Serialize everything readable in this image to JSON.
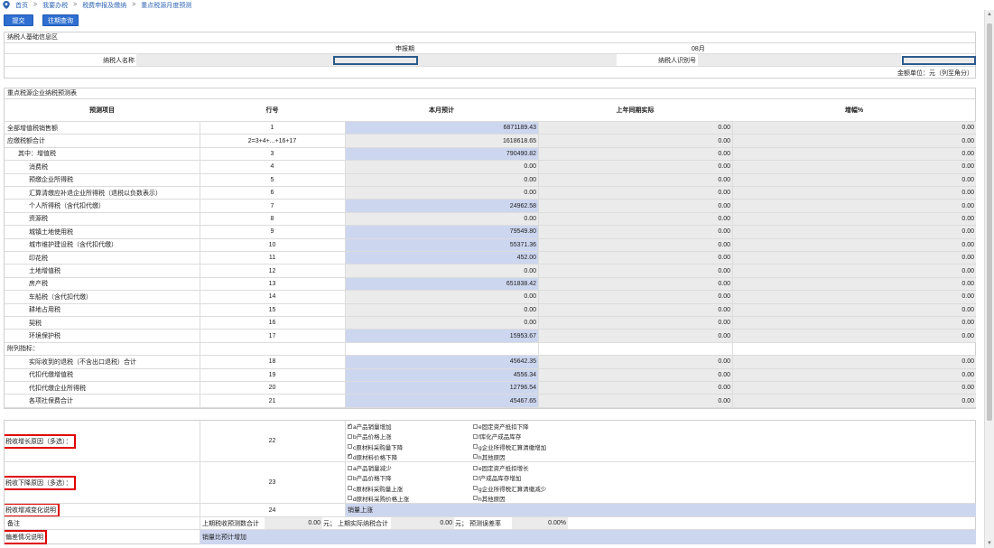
{
  "breadcrumb": {
    "items": [
      "首页",
      "我要办税",
      "税费申报及缴纳",
      "重点税源月度预测"
    ],
    "sep": ">"
  },
  "toolbar": {
    "submit": "提交",
    "history": "往期查询"
  },
  "base": {
    "title": "纳税人基础信息区",
    "period_label": "申报期",
    "period_value": "08月",
    "name_label": "纳税人名称",
    "id_label": "纳税人识别号",
    "unit": "金额单位：元（列至角分）"
  },
  "forecast": {
    "title": "重点税源企业纳税预测表",
    "headers": [
      "预测项目",
      "行号",
      "本月预计",
      "上年同期实际",
      "增幅%"
    ],
    "rows": [
      {
        "name": "全部增值税销售额",
        "no": "1",
        "cur": "6871189.43",
        "prev": "0.00",
        "pct": "0.00",
        "indent": 0,
        "shade": "blue"
      },
      {
        "name": "应缴税额合计",
        "no": "2=3+4+...+16+17",
        "cur": "1618618.65",
        "prev": "0.00",
        "pct": "0.00",
        "indent": 0,
        "shade": "grey"
      },
      {
        "name": "其中：增值税",
        "no": "3",
        "cur": "790490.82",
        "prev": "0.00",
        "pct": "0.00",
        "indent": 1,
        "shade": "blue"
      },
      {
        "name": "消费税",
        "no": "4",
        "cur": "0.00",
        "prev": "0.00",
        "pct": "0.00",
        "indent": 2,
        "shade": "grey"
      },
      {
        "name": "预缴企业所得税",
        "no": "5",
        "cur": "0.00",
        "prev": "0.00",
        "pct": "0.00",
        "indent": 2,
        "shade": "grey"
      },
      {
        "name": "汇算清缴应补退企业所得税（退税以负数表示）",
        "no": "6",
        "cur": "0.00",
        "prev": "0.00",
        "pct": "0.00",
        "indent": 2,
        "shade": "grey"
      },
      {
        "name": "个人所得税（含代扣代缴）",
        "no": "7",
        "cur": "24962.58",
        "prev": "0.00",
        "pct": "0.00",
        "indent": 2,
        "shade": "blue"
      },
      {
        "name": "资源税",
        "no": "8",
        "cur": "0.00",
        "prev": "0.00",
        "pct": "0.00",
        "indent": 2,
        "shade": "grey"
      },
      {
        "name": "城镇土地使用税",
        "no": "9",
        "cur": "79549.80",
        "prev": "0.00",
        "pct": "0.00",
        "indent": 2,
        "shade": "blue"
      },
      {
        "name": "城市维护建设税（含代扣代缴）",
        "no": "10",
        "cur": "55371.36",
        "prev": "0.00",
        "pct": "0.00",
        "indent": 2,
        "shade": "blue"
      },
      {
        "name": "印花税",
        "no": "11",
        "cur": "452.00",
        "prev": "0.00",
        "pct": "0.00",
        "indent": 2,
        "shade": "blue"
      },
      {
        "name": "土地增值税",
        "no": "12",
        "cur": "0.00",
        "prev": "0.00",
        "pct": "0.00",
        "indent": 2,
        "shade": "grey"
      },
      {
        "name": "房产税",
        "no": "13",
        "cur": "651838.42",
        "prev": "0.00",
        "pct": "0.00",
        "indent": 2,
        "shade": "blue"
      },
      {
        "name": "车船税（含代扣代缴）",
        "no": "14",
        "cur": "0.00",
        "prev": "0.00",
        "pct": "0.00",
        "indent": 2,
        "shade": "grey"
      },
      {
        "name": "耕地占用税",
        "no": "15",
        "cur": "0.00",
        "prev": "0.00",
        "pct": "0.00",
        "indent": 2,
        "shade": "grey"
      },
      {
        "name": "契税",
        "no": "16",
        "cur": "0.00",
        "prev": "0.00",
        "pct": "0.00",
        "indent": 2,
        "shade": "grey"
      },
      {
        "name": "环境保护税",
        "no": "17",
        "cur": "15953.67",
        "prev": "0.00",
        "pct": "0.00",
        "indent": 2,
        "shade": "blue"
      },
      {
        "name": "附列指标：",
        "no": "",
        "cur": "",
        "prev": "",
        "pct": "",
        "indent": 0,
        "shade": "none"
      },
      {
        "name": "实际收到的退税（不含出口退税）合计",
        "no": "18",
        "cur": "45642.35",
        "prev": "0.00",
        "pct": "0.00",
        "indent": 2,
        "shade": "blue"
      },
      {
        "name": "代扣代缴增值税",
        "no": "19",
        "cur": "4556.34",
        "prev": "0.00",
        "pct": "0.00",
        "indent": 2,
        "shade": "blue"
      },
      {
        "name": "代扣代缴企业所得税",
        "no": "20",
        "cur": "12796.54",
        "prev": "0.00",
        "pct": "0.00",
        "indent": 2,
        "shade": "blue"
      },
      {
        "name": "各项社保费合计",
        "no": "21",
        "cur": "45467.65",
        "prev": "0.00",
        "pct": "0.00",
        "indent": 2,
        "shade": "blue"
      }
    ]
  },
  "reasons": {
    "increase": {
      "label": "税收增长原因（多选）：",
      "no": "22",
      "left": [
        {
          "text": "a产品销量增加",
          "checked": true
        },
        {
          "text": "b产品价格上涨",
          "checked": false
        },
        {
          "text": "c原材料采购量下降",
          "checked": false
        },
        {
          "text": "d原材料价格下降",
          "checked": true
        }
      ],
      "right": [
        {
          "text": "e固定资产抵扣下降",
          "checked": false
        },
        {
          "text": "f库化产成品库存",
          "checked": false
        },
        {
          "text": "g企业所得税汇算清缴增加",
          "checked": false
        },
        {
          "text": "h其他原因",
          "checked": false
        }
      ]
    },
    "decrease": {
      "label": "税收下降原因（多选）：",
      "no": "23",
      "left": [
        {
          "text": "a产品销量减少",
          "checked": false
        },
        {
          "text": "b产品价格下降",
          "checked": false
        },
        {
          "text": "c原材料采购量上涨",
          "checked": false
        },
        {
          "text": "d原材料采购价格上涨",
          "checked": false
        }
      ],
      "right": [
        {
          "text": "e固定资产抵扣增长",
          "checked": false
        },
        {
          "text": "f产成品库存增加",
          "checked": false
        },
        {
          "text": "g企业所得税汇算清缴减少",
          "checked": false
        },
        {
          "text": "h其他原因",
          "checked": false
        }
      ]
    },
    "change": {
      "label": "税收增减变化说明",
      "no": "24",
      "value": "销量上涨"
    },
    "remark": {
      "label": "备注",
      "f1_label": "上期税收预测数合计",
      "f1_value": "0.00",
      "f1_unit": "元；",
      "f2_label": "上期实际纳税合计",
      "f2_value": "0.00",
      "f2_unit": "元；",
      "f3_label": "预测误差率",
      "f3_value": "0.00%"
    },
    "deviation": {
      "label": "偏差情况说明",
      "value": "销量比预计增加"
    }
  }
}
